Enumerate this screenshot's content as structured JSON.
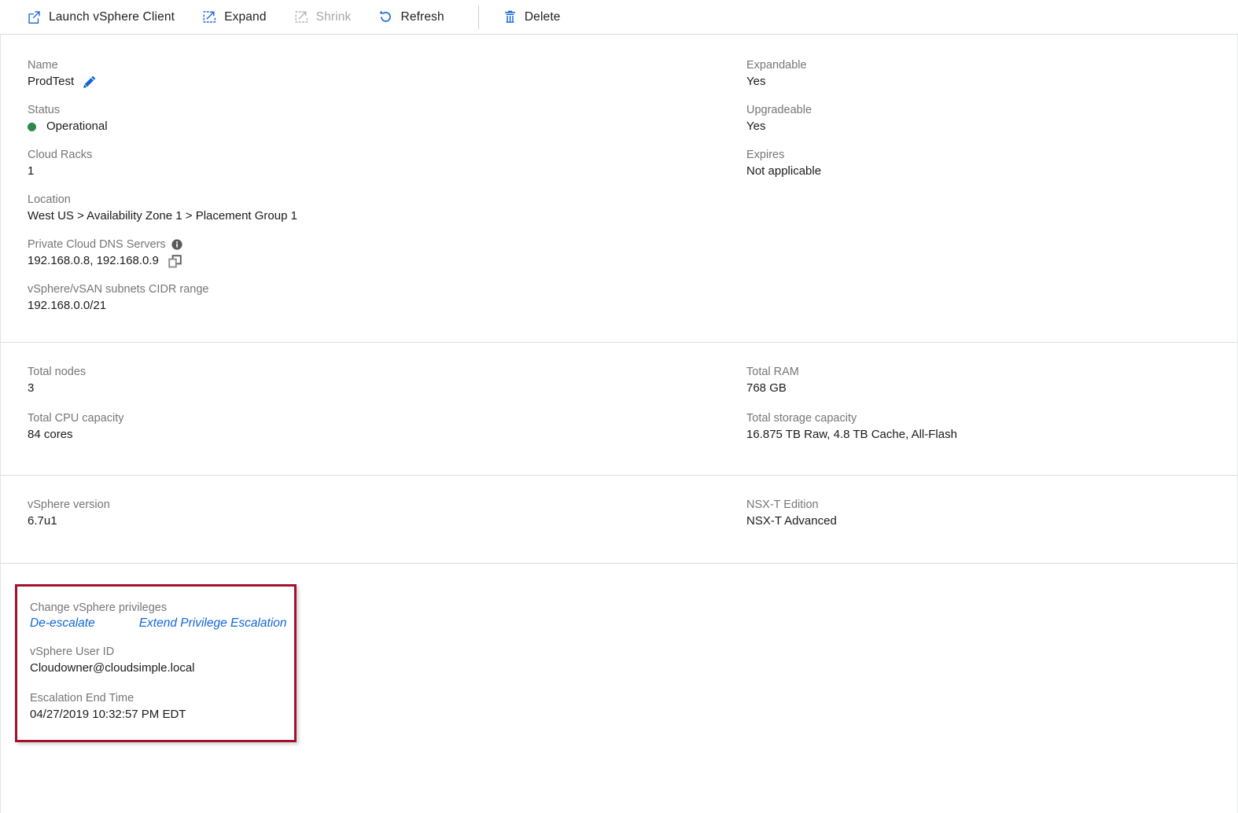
{
  "toolbar": {
    "buttons": [
      {
        "label": "Launch vSphere Client",
        "icon": "external-link-icon",
        "disabled": false
      },
      {
        "label": "Expand",
        "icon": "expand-icon",
        "disabled": false
      },
      {
        "label": "Shrink",
        "icon": "shrink-icon",
        "disabled": true
      },
      {
        "label": "Refresh",
        "icon": "refresh-icon",
        "disabled": false
      },
      {
        "label": "Delete",
        "icon": "trash-icon",
        "disabled": false
      }
    ]
  },
  "overview": {
    "left": {
      "name_label": "Name",
      "name_value": "ProdTest",
      "edit_icon": "pencil-icon",
      "status_label": "Status",
      "status_value": "Operational",
      "status_color": "#2d8a4e",
      "cloud_racks_label": "Cloud Racks",
      "cloud_racks_value": "1",
      "location_label": "Location",
      "location_value": "West US > Availability Zone 1 > Placement Group 1",
      "dns_label": "Private Cloud DNS Servers",
      "dns_info_icon": "info-icon",
      "dns_value": "192.168.0.8, 192.168.0.9",
      "dns_copy_icon": "copy-icon",
      "cidr_label": "vSphere/vSAN subnets CIDR range",
      "cidr_value": "192.168.0.0/21"
    },
    "right": {
      "expandable_label": "Expandable",
      "expandable_value": "Yes",
      "upgradeable_label": "Upgradeable",
      "upgradeable_value": "Yes",
      "expires_label": "Expires",
      "expires_value": "Not applicable"
    }
  },
  "capacity": {
    "left": {
      "total_nodes_label": "Total nodes",
      "total_nodes_value": "3",
      "total_cpu_label": "Total CPU capacity",
      "total_cpu_value": "84 cores"
    },
    "right": {
      "total_ram_label": "Total RAM",
      "total_ram_value": "768 GB",
      "total_storage_label": "Total storage capacity",
      "total_storage_value": "16.875 TB Raw, 4.8 TB Cache, All-Flash"
    }
  },
  "versions": {
    "left": {
      "vsphere_version_label": "vSphere version",
      "vsphere_version_value": "6.7u1"
    },
    "right": {
      "nsxt_edition_label": "NSX-T Edition",
      "nsxt_edition_value": "NSX-T Advanced"
    }
  },
  "privileges": {
    "change_label": "Change vSphere privileges",
    "deescalate_link": "De-escalate",
    "extend_link": "Extend Privilege Escalation",
    "user_id_label": "vSphere User ID",
    "user_id_value": "Cloudowner@cloudsimple.local",
    "end_time_label": "Escalation End Time",
    "end_time_value": "04/27/2019 10:32:57 PM EDT",
    "highlight_color": "#a3122b"
  },
  "colors": {
    "accent_blue": "#1266d6",
    "status_green": "#2d8a4e",
    "highlight_red": "#a3122b",
    "label_gray": "#767676"
  }
}
